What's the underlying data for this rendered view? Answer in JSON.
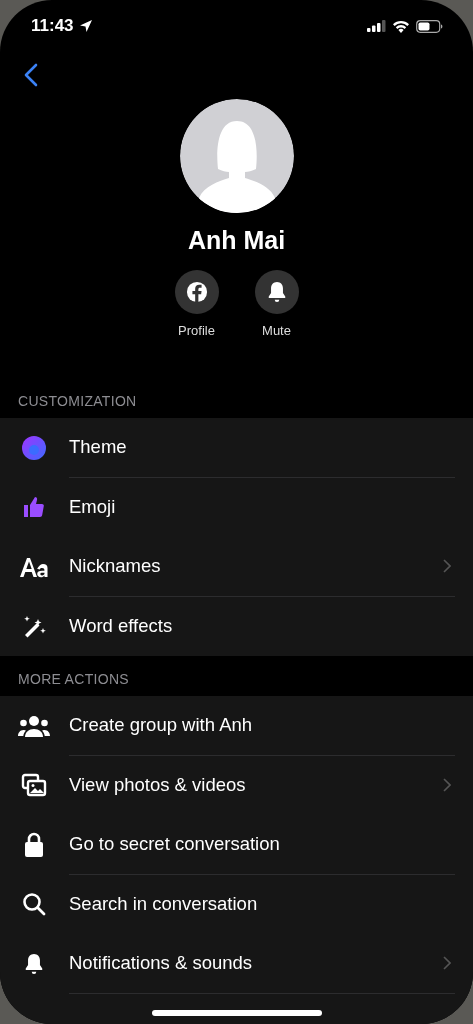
{
  "status_bar": {
    "time": "11:43"
  },
  "profile": {
    "name": "Anh Mai"
  },
  "actions": [
    {
      "kind": "facebook",
      "label": "Profile"
    },
    {
      "kind": "bell",
      "label": "Mute"
    }
  ],
  "sections": [
    {
      "title": "CUSTOMIZATION",
      "items": [
        {
          "kind": "theme",
          "label": "Theme",
          "chevron": false
        },
        {
          "kind": "thumb",
          "label": "Emoji",
          "chevron": false
        },
        {
          "kind": "text",
          "label": "Nicknames",
          "chevron": true
        },
        {
          "kind": "sparkle",
          "label": "Word effects",
          "chevron": false
        }
      ]
    },
    {
      "title": "MORE ACTIONS",
      "items": [
        {
          "kind": "group",
          "label": "Create group with Anh",
          "chevron": false
        },
        {
          "kind": "photos",
          "label": "View photos & videos",
          "chevron": true
        },
        {
          "kind": "lock",
          "label": "Go to secret conversation",
          "chevron": false
        },
        {
          "kind": "search",
          "label": "Search in conversation",
          "chevron": false
        },
        {
          "kind": "bell",
          "label": "Notifications & sounds",
          "chevron": true
        }
      ]
    }
  ]
}
